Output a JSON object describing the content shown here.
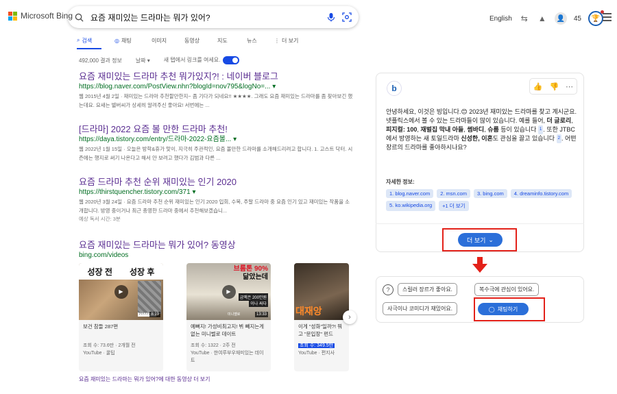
{
  "header": {
    "logo_text": "Microsoft Bing",
    "query": "요즘 재미있는 드라마는 뭐가 있어?",
    "language": "English",
    "points": "45"
  },
  "tabs": [
    {
      "label": "검색",
      "icon": "search-icon",
      "active": true
    },
    {
      "label": "채팅",
      "icon": "chat-icon",
      "active": false
    },
    {
      "label": "이미지",
      "icon": "",
      "active": false
    },
    {
      "label": "동영상",
      "icon": "",
      "active": false
    },
    {
      "label": "지도",
      "icon": "",
      "active": false
    },
    {
      "label": "뉴스",
      "icon": "",
      "active": false
    },
    {
      "label": "더 보기",
      "icon": "more-icon",
      "active": false
    }
  ],
  "meta": {
    "result_count": "492,000 결과 정보",
    "date_filter": "날짜",
    "new_tab_label": "새 탭에서 링크를 여세요."
  },
  "results": [
    {
      "title": "요즘 재미있는 드라마 추천 뭐가있지?! : 네이버 블로그",
      "url": "https://blog.naver.com/PostView.nhn?blogId=nov795&logNo=...",
      "snippet": "웹 2015년 4월 2일 · 재미있는 드라마 추천할만한지~ 좀 기다가 되네요!! ★★★★. 그래도 요즘 재미있는 드라마를 좀 찾아보긴 했는데요. 요새는 별버씨가 상세히 알려주신 좋아요! 서번에는 ..."
    },
    {
      "title": "[드라마] 2022 요즘 볼 만한 드라마 추천!",
      "url": "https://daya.tistory.com/entry/드라마-2022-요즘볼...",
      "snippet": "웹 2022년 1월 15일 · 오늘은 방학&휴가 맞이, 지극히 주관적인, 요즘 볼만한 드라마를 소개해드리려고 합니다. 1. 고스트 닥터. 시즌에는 행지로 써기 나온다고 해서 안 보려고 했다가 김범과 다른 ..."
    },
    {
      "title": "요즘 드라마 추천 순위 재미있는 인기 2020",
      "url": "https://thirstquencher.tistory.com/371",
      "snippet": "웹 2020년 3월 24일 · 요즘 드라마 추천 순위 재미있는 인기 2020 입회, 수목, 주말 드라마 중 요즘 인기 있고 재미있는 작품을 소개합니다. 방영 중이거나 최근 종영한 드라마 중에서 추천해보겠습니...",
      "extra": "예상 독서 시간: 3분"
    }
  ],
  "videos": {
    "heading": "요즘 재미있는 드라마는 뭐가 있어? 동영상",
    "source": "bing.com/videos",
    "items": [
      {
        "title": "보건 참들 287편",
        "views": "조회 수: 73.6만 · 2개월 전",
        "channel": "YouTube · 꿀팁",
        "duration": "8:19",
        "overlay1": "성장 전",
        "overlay2": "성장 후",
        "thumb_tag": "?????????"
      },
      {
        "title": "예뻐지! 가성비최고지! 뷔 빼지는게 없는 미니벨로 데이트",
        "views": "조회 수: 1322 · 2주 전",
        "channel": "YouTube · 한여루부우재미있는 데이트",
        "duration": "13:33",
        "overlay1": "브롬톤 90%",
        "overlay2": "닮았는데",
        "overlay3": "금액은 200만원",
        "overlay4": "이나 싸다",
        "overlay5": "미니벨로"
      },
      {
        "title": "이게 \"성화\"일까?! 뭐고 \"문입장\" 펀드",
        "views": "조회 수: 349.5만",
        "channel": "YouTube · 편지사",
        "overlay1": "대재앙"
      }
    ],
    "see_more": "요즘 재미있는 드라마는 뭐가 있어?에 대한 동영상 더 보기"
  },
  "chat": {
    "para1_pre": "안녕하세요, 이것은 빙입니다.😊 2023년 재미있는 드라마를 찾고 계시군요. 넷플릭스에서 볼 수 있는 드라마들이 많이 있습니다. 예를 들어, ",
    "b1": "더 글로리",
    "sep1": ", ",
    "b2": "피지컬: 100",
    "sep2": ", ",
    "b3": "재벌집 막내 아들",
    "sep3": ", ",
    "b4": "썸바디",
    "sep4": ", ",
    "b5": "슈룹",
    "para1_post": " 등이 있습니다",
    "ref1": "1",
    "para1_tail": ". 또한 JTBC에서 방영하는 새 토일드라마 ",
    "b6": "신성한, 이혼",
    "para1_tail2": "도 관심을 끌고 있습니다",
    "ref2": "2",
    "para1_end": ". 어떤 장르의 드라마를 좋아하시나요?",
    "learn_more": "자세한 정보:",
    "sources": [
      "1. blog.naver.com",
      "2. msn.com",
      "3. bing.com",
      "4. dreaminfo.tistory.com",
      "5. ko.wikipedia.org",
      "+1 더 보기"
    ],
    "more_button": "더 보기",
    "suggestions": [
      "스릴러 장르가 좋아요.",
      "복수극에 관심이 있어요.",
      "사극이나 코미디가 재밌어요."
    ],
    "chat_button": "채팅하기"
  },
  "colors": {
    "accent": "#174ae4",
    "title_purple": "#5a2d91",
    "url_green": "#006d21",
    "annotation_red": "#e32119",
    "button_blue": "#2b6fd9"
  }
}
